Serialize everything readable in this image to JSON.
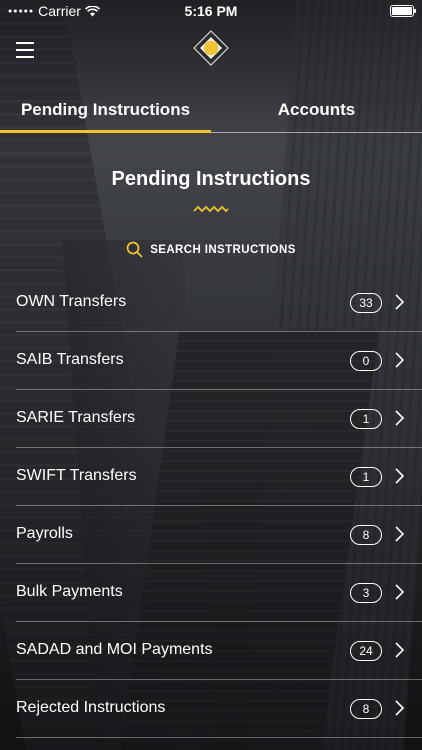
{
  "status_bar": {
    "carrier": "Carrier",
    "time": "5:16 PM"
  },
  "tabs": [
    {
      "label": "Pending Instructions"
    },
    {
      "label": "Accounts"
    }
  ],
  "section_title": "Pending Instructions",
  "search": {
    "label": "SEARCH INSTRUCTIONS"
  },
  "items": [
    {
      "label": "OWN Transfers",
      "count": "33"
    },
    {
      "label": "SAIB Transfers",
      "count": "0"
    },
    {
      "label": "SARIE Transfers",
      "count": "1"
    },
    {
      "label": "SWIFT Transfers",
      "count": "1"
    },
    {
      "label": "Payrolls",
      "count": "8"
    },
    {
      "label": "Bulk Payments",
      "count": "3"
    },
    {
      "label": "SADAD and MOI Payments",
      "count": "24"
    },
    {
      "label": "Rejected Instructions",
      "count": "8"
    }
  ],
  "colors": {
    "accent": "#f2c230",
    "logo_dark": "#2b2b2b"
  },
  "icons": [
    "menu-icon",
    "logo",
    "search-icon",
    "zigzag-icon",
    "chevron-right-icon",
    "wifi-icon",
    "battery-icon"
  ]
}
